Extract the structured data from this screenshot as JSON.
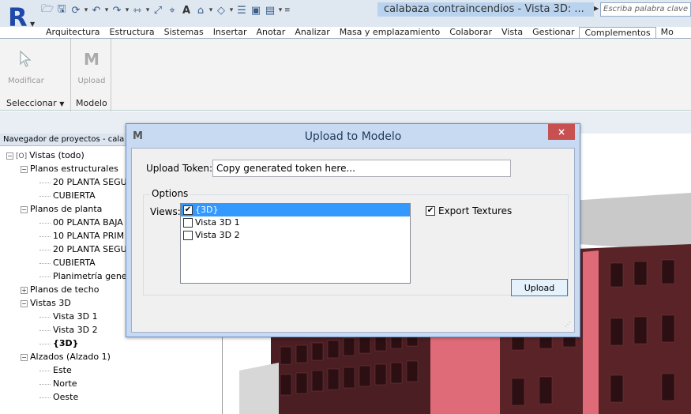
{
  "app": {
    "title": "calabaza contraincendios - Vista 3D: ...",
    "search_placeholder": "Escriba palabra clave o fra"
  },
  "ribbon": {
    "tabs": [
      "Arquitectura",
      "Estructura",
      "Sistemas",
      "Insertar",
      "Anotar",
      "Analizar",
      "Masa y emplazamiento",
      "Colaborar",
      "Vista",
      "Gestionar",
      "Complementos",
      "Mo"
    ],
    "active_tab": "Complementos",
    "modify_label": "Modificar",
    "upload_label": "Upload",
    "panel_select": "Seleccionar",
    "panel_modelo": "Modelo"
  },
  "browser": {
    "title": "Navegador de proyectos - cala",
    "items": [
      {
        "label": "Vistas (todo)",
        "level": 0,
        "toggle": "−"
      },
      {
        "label": "Planos estructurales",
        "level": 1,
        "toggle": "−"
      },
      {
        "label": "20 PLANTA SEGU",
        "level": 2,
        "toggle": ""
      },
      {
        "label": "CUBIERTA",
        "level": 2,
        "toggle": ""
      },
      {
        "label": "Planos de planta",
        "level": 1,
        "toggle": "−"
      },
      {
        "label": "00 PLANTA BAJA",
        "level": 2,
        "toggle": ""
      },
      {
        "label": "10 PLANTA PRIM",
        "level": 2,
        "toggle": ""
      },
      {
        "label": "20 PLANTA SEGU",
        "level": 2,
        "toggle": ""
      },
      {
        "label": "CUBIERTA",
        "level": 2,
        "toggle": ""
      },
      {
        "label": "Planimetría gene",
        "level": 2,
        "toggle": ""
      },
      {
        "label": "Planos de techo",
        "level": 1,
        "toggle": "+"
      },
      {
        "label": "Vistas 3D",
        "level": 1,
        "toggle": "−"
      },
      {
        "label": "Vista 3D 1",
        "level": 2,
        "toggle": ""
      },
      {
        "label": "Vista 3D 2",
        "level": 2,
        "toggle": ""
      },
      {
        "label": "{3D}",
        "level": 2,
        "toggle": "",
        "bold": true
      },
      {
        "label": "Alzados (Alzado 1)",
        "level": 1,
        "toggle": "−"
      },
      {
        "label": "Este",
        "level": 2,
        "toggle": ""
      },
      {
        "label": "Norte",
        "level": 2,
        "toggle": ""
      },
      {
        "label": "Oeste",
        "level": 2,
        "toggle": ""
      }
    ]
  },
  "dialog": {
    "logo": "M",
    "title": "Upload to Modelo",
    "close": "×",
    "token_label": "Upload Token:",
    "token_value": "Copy generated token here...",
    "options_label": "Options",
    "views_label": "Views:",
    "views": [
      {
        "label": "{3D}",
        "checked": true,
        "selected": true
      },
      {
        "label": "Vista 3D 1",
        "checked": false,
        "selected": false
      },
      {
        "label": "Vista 3D 2",
        "checked": false,
        "selected": false
      }
    ],
    "export_textures_label": "Export Textures",
    "export_textures_checked": true,
    "upload_button": "Upload"
  },
  "colors": {
    "title_highlight": "#b9d3ef",
    "dialog_frame": "#c8daf2",
    "close_button": "#c75050",
    "selection": "#3399ff",
    "building_brick": "#6b2b2e",
    "building_accent": "#e06b78"
  }
}
